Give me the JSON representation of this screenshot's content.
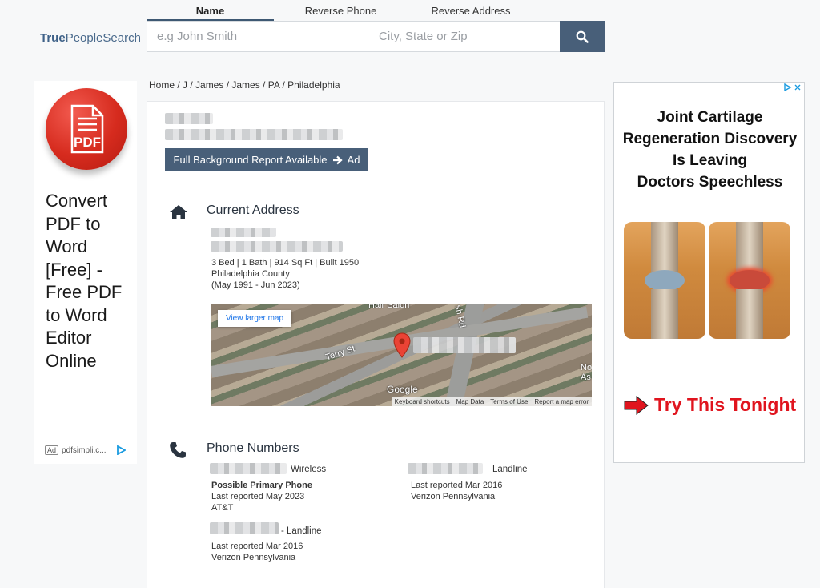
{
  "header": {
    "logo_part1": "True",
    "logo_part2": "PeopleSearch",
    "tabs": [
      {
        "label": "Name"
      },
      {
        "label": "Reverse Phone"
      },
      {
        "label": "Reverse Address"
      }
    ],
    "name_placeholder": "e.g John Smith",
    "location_placeholder": "City, State or Zip",
    "search_icon": "search-icon"
  },
  "left_ad": {
    "icon_text": "PDF",
    "headline": "Convert PDF to Word [Free] - Free PDF to Word Editor Online",
    "badge": "Ad",
    "domain": "pdfsimpli.c..."
  },
  "breadcrumb": "Home / J / James / James / PA / Philadelphia",
  "profile": {
    "report_button": "Full Background Report Available",
    "report_badge": "Ad"
  },
  "current_address": {
    "title": "Current Address",
    "details": "3 Bed | 1 Bath | 914 Sq Ft | Built 1950",
    "county": "Philadelphia County",
    "dates": "(May 1991 - Jun 2023)",
    "map": {
      "larger_map": "View larger map",
      "label_terry": "Terry St",
      "label_hair": "Hair Salon",
      "label_rd": "sh Rd",
      "label_no": "No",
      "label_as": "As",
      "google": "Google",
      "footer": [
        "Keyboard shortcuts",
        "Map Data",
        "Terms of Use",
        "Report a map error"
      ]
    }
  },
  "phone_numbers": {
    "title": "Phone Numbers",
    "phones": [
      {
        "type": "Wireless",
        "note": "Possible Primary Phone",
        "reported": "Last reported May 2023",
        "carrier": "AT&T"
      },
      {
        "type": "Landline",
        "reported": "Last reported Mar 2016",
        "carrier": "Verizon Pennsylvania"
      },
      {
        "type": "- Landline",
        "reported": "Last reported Mar 2016",
        "carrier": "Verizon Pennsylvania"
      }
    ]
  },
  "right_ad": {
    "title_lines": [
      "Joint Cartilage",
      "Regeneration Discovery",
      "Is Leaving",
      "Doctors Speechless"
    ],
    "cta": "Try This Tonight"
  },
  "colors": {
    "brand_dark": "#485f79",
    "logo": "#3e6188",
    "ad_red": "#e0141e"
  }
}
